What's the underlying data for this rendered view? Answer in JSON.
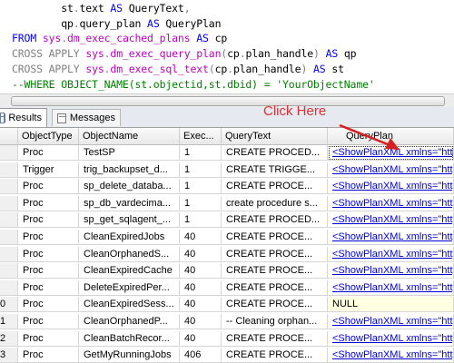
{
  "editor": {
    "lines": [
      [
        {
          "t": "        st",
          "c": "txt"
        },
        {
          "t": ".",
          "c": "gray"
        },
        {
          "t": "text ",
          "c": "txt"
        },
        {
          "t": "AS",
          "c": "kw"
        },
        {
          "t": " QueryText",
          "c": "txt"
        },
        {
          "t": ",",
          "c": "gray"
        }
      ],
      [
        {
          "t": "        qp",
          "c": "txt"
        },
        {
          "t": ".",
          "c": "gray"
        },
        {
          "t": "query_plan ",
          "c": "txt"
        },
        {
          "t": "AS",
          "c": "kw"
        },
        {
          "t": " QueryPlan",
          "c": "txt"
        }
      ],
      [
        {
          "t": "FROM",
          "c": "kw"
        },
        {
          "t": " ",
          "c": "txt"
        },
        {
          "t": "sys",
          "c": "fn"
        },
        {
          "t": ".",
          "c": "gray"
        },
        {
          "t": "dm_exec_cached_plans",
          "c": "fn"
        },
        {
          "t": " ",
          "c": "txt"
        },
        {
          "t": "AS",
          "c": "kw"
        },
        {
          "t": " cp",
          "c": "txt"
        }
      ],
      [
        {
          "t": "CROSS",
          "c": "gray"
        },
        {
          "t": " ",
          "c": "txt"
        },
        {
          "t": "APPLY",
          "c": "gray"
        },
        {
          "t": " ",
          "c": "txt"
        },
        {
          "t": "sys",
          "c": "fn"
        },
        {
          "t": ".",
          "c": "gray"
        },
        {
          "t": "dm_exec_query_plan",
          "c": "fn"
        },
        {
          "t": "(",
          "c": "gray"
        },
        {
          "t": "cp",
          "c": "txt"
        },
        {
          "t": ".",
          "c": "gray"
        },
        {
          "t": "plan_handle",
          "c": "txt"
        },
        {
          "t": ")",
          "c": "gray"
        },
        {
          "t": " ",
          "c": "txt"
        },
        {
          "t": "AS",
          "c": "kw"
        },
        {
          "t": " qp",
          "c": "txt"
        }
      ],
      [
        {
          "t": "CROSS",
          "c": "gray"
        },
        {
          "t": " ",
          "c": "txt"
        },
        {
          "t": "APPLY",
          "c": "gray"
        },
        {
          "t": " ",
          "c": "txt"
        },
        {
          "t": "sys",
          "c": "fn"
        },
        {
          "t": ".",
          "c": "gray"
        },
        {
          "t": "dm_exec_sql_text",
          "c": "fn"
        },
        {
          "t": "(",
          "c": "gray"
        },
        {
          "t": "cp",
          "c": "txt"
        },
        {
          "t": ".",
          "c": "gray"
        },
        {
          "t": "plan_handle",
          "c": "txt"
        },
        {
          "t": ")",
          "c": "gray"
        },
        {
          "t": " ",
          "c": "txt"
        },
        {
          "t": "AS",
          "c": "kw"
        },
        {
          "t": " st",
          "c": "txt"
        }
      ],
      [
        {
          "t": "--WHERE OBJECT_NAME(st.objectid,st.dbid) = 'YourObjectName'",
          "c": "cm"
        }
      ]
    ]
  },
  "tabs": {
    "results_label": "Results",
    "messages_label": "Messages"
  },
  "annotation": {
    "label": "Click Here",
    "color": "#e03030"
  },
  "grid": {
    "columns": [
      "ObjectType",
      "ObjectName",
      "Exec...",
      "QueryText",
      "QueryPlan"
    ],
    "rows": [
      {
        "n": "",
        "type": "Proc",
        "name": "TestSP",
        "exec": "1",
        "text": "CREATE PROCED...",
        "plan": "<ShowPlanXML xmlns=\"http"
      },
      {
        "n": "",
        "type": "Trigger",
        "name": "trig_backupset_d...",
        "exec": "1",
        "text": "  CREATE TRIGGE...",
        "plan": "<ShowPlanXML xmlns=\"http"
      },
      {
        "n": "",
        "type": "Proc",
        "name": "sp_delete_databa...",
        "exec": "1",
        "text": "CREATE   PROCE...",
        "plan": "<ShowPlanXML xmlns=\"http"
      },
      {
        "n": "",
        "type": "Proc",
        "name": "sp_db_vardecima...",
        "exec": "1",
        "text": "create procedure s...",
        "plan": "<ShowPlanXML xmlns=\"http"
      },
      {
        "n": "",
        "type": "Proc",
        "name": "sp_get_sqlagent_...",
        "exec": "1",
        "text": "CREATE PROCED...",
        "plan": "<ShowPlanXML xmlns=\"http"
      },
      {
        "n": "",
        "type": "Proc",
        "name": "CleanExpiredJobs",
        "exec": "40",
        "text": "CREATE PROCE...",
        "plan": "<ShowPlanXML xmlns=\"http"
      },
      {
        "n": "",
        "type": "Proc",
        "name": "CleanOrphanedS...",
        "exec": "40",
        "text": "CREATE PROCE...",
        "plan": "<ShowPlanXML xmlns=\"http"
      },
      {
        "n": "",
        "type": "Proc",
        "name": "CleanExpiredCache",
        "exec": "40",
        "text": "CREATE PROCE...",
        "plan": "<ShowPlanXML xmlns=\"http"
      },
      {
        "n": "",
        "type": "Proc",
        "name": "DeleteExpiredPer...",
        "exec": "40",
        "text": "CREATE PROCE...",
        "plan": "<ShowPlanXML xmlns=\"http"
      },
      {
        "n": "0",
        "type": "Proc",
        "name": "CleanExpiredSess...",
        "exec": "40",
        "text": "CREATE PROCE...",
        "plan": "NULL"
      },
      {
        "n": "1",
        "type": "Proc",
        "name": "CleanOrphanedP...",
        "exec": "40",
        "text": " -- Cleaning orphan...",
        "plan": "<ShowPlanXML xmlns=\"http"
      },
      {
        "n": "2",
        "type": "Proc",
        "name": "CleanBatchRecor...",
        "exec": "40",
        "text": "CREATE PROCE...",
        "plan": "<ShowPlanXML xmlns=\"http"
      },
      {
        "n": "3",
        "type": "Proc",
        "name": "GetMyRunningJobs",
        "exec": "406",
        "text": "CREATE PROCE...",
        "plan": "<ShowPlanXML xmlns=\"http"
      }
    ]
  }
}
